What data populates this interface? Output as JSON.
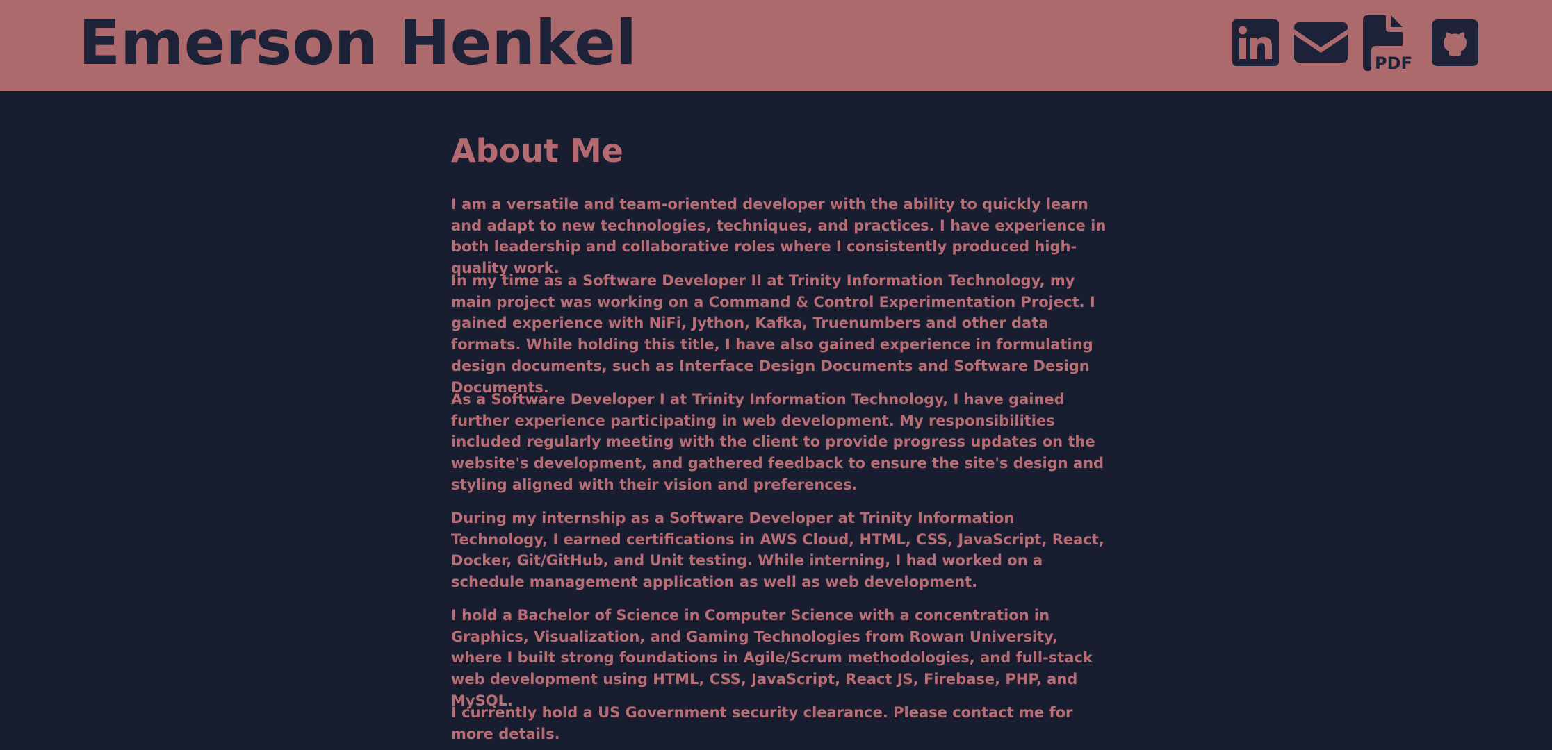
{
  "header": {
    "name": "Emerson Henkel",
    "links": [
      {
        "icon": "linkedin-icon"
      },
      {
        "icon": "email-icon"
      },
      {
        "icon": "pdf-resume-icon",
        "label": "PDF"
      },
      {
        "icon": "github-icon"
      }
    ]
  },
  "colors": {
    "header_bg": "#ad6a6c",
    "page_bg": "#181d30",
    "title_text": "#1d2238",
    "accent_text": "#b56a72"
  },
  "about": {
    "heading": "About Me",
    "paragraphs": [
      "I am a versatile and team-oriented developer with the ability to quickly learn and adapt to new technologies, techniques, and practices. I have experience in both leadership and collaborative roles where I consistently produced high-quality work.",
      "In my time as a Software Developer II at Trinity Information Technology, my main project was working on a Command & Control Experimentation Project. I gained experience with NiFi, Jython, Kafka, Truenumbers and other data formats. While holding this title, I have also gained experience in formulating design documents, such as Interface Design Documents and Software Design Documents.",
      "As a Software Developer I at Trinity Information Technology, I have gained further experience participating in web development. My responsibilities included regularly meeting with the client to provide progress updates on the website's development, and gathered feedback to ensure the site's design and styling aligned with their vision and preferences.",
      "During my internship as a Software Developer at Trinity Information Technology, I earned certifications in AWS Cloud, HTML, CSS, JavaScript, React, Docker, Git/GitHub, and Unit testing. While interning, I had worked on a schedule management application as well as web development.",
      "I hold a Bachelor of Science in Computer Science with a concentration in Graphics, Visualization, and Gaming Technologies from Rowan University, where I built strong foundations in Agile/Scrum methodologies, and full-stack web development using HTML, CSS, JavaScript, React JS, Firebase, PHP, and MySQL.",
      "I currently hold a US Government security clearance. Please contact me for more details."
    ]
  }
}
